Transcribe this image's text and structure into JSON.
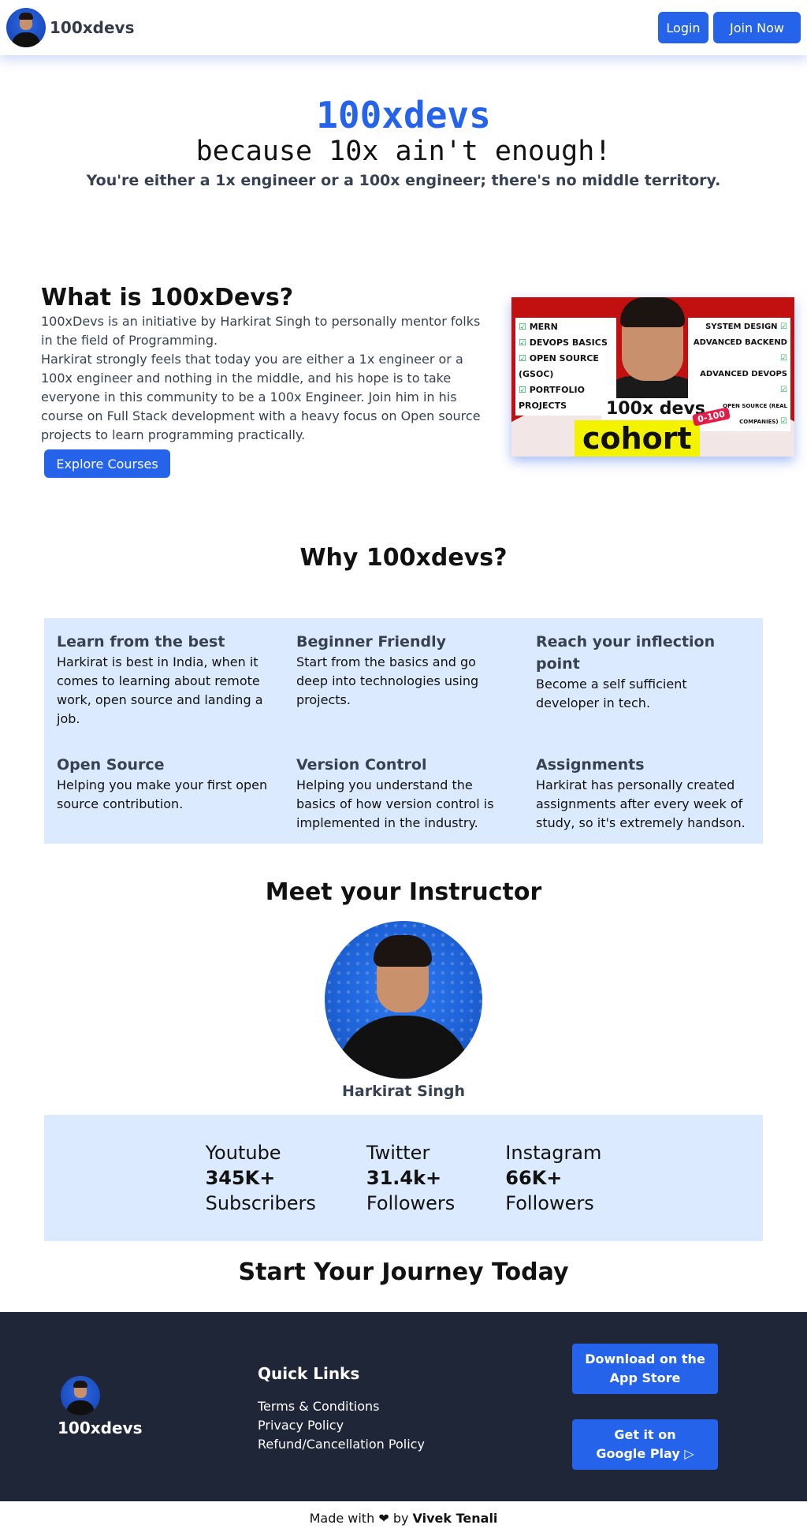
{
  "nav": {
    "brand": "100xdevs",
    "login": "Login",
    "join": "Join Now"
  },
  "hero": {
    "title": "100xdevs",
    "subtitle": "because 10x ain't enough!",
    "tagline": "You're either a 1x engineer or a 100x engineer; there's no middle territory."
  },
  "about": {
    "title": "What is 100xDevs?",
    "para1": "100xDevs is an initiative by Harkirat Singh to personally mentor folks in the field of Programming.",
    "para2": "Harkirat strongly feels that today you are either a 1x engineer or a 100x engineer and nothing in the middle, and his hope is to take everyone in this community to be a 100x Engineer. Join him in his course on Full Stack development with a heavy focus on Open source projects to learn programming practically.",
    "cta": "Explore Courses",
    "cover": {
      "left_items": [
        "MERN",
        "DEVOPS BASICS",
        "OPEN SOURCE (GSOC)",
        "PORTFOLIO PROJECTS"
      ],
      "right_items": [
        "SYSTEM DESIGN",
        "ADVANCED BACKEND",
        "ADVANCED DEVOPS",
        "OPEN SOURCE (REAL COMPANIES)"
      ],
      "label": "100x devs",
      "badge": "0-100",
      "big": "cohort"
    }
  },
  "why": {
    "title": "Why 100xdevs?",
    "features": [
      {
        "title": "Learn from the best",
        "desc": "Harkirat is best in India, when it comes to learning about remote work, open source and landing a job."
      },
      {
        "title": "Beginner Friendly",
        "desc": "Start from the basics and go deep into technologies using projects."
      },
      {
        "title": "Reach your inflection point",
        "desc": "Become a self sufficient developer in tech."
      },
      {
        "title": "Open Source",
        "desc": "Helping you make your first open source contribution."
      },
      {
        "title": "Version Control",
        "desc": "Helping you understand the basics of how version control is implemented in the industry."
      },
      {
        "title": "Assignments",
        "desc": "Harkirat has personally created assignments after every week of study, so it's extremely handson."
      }
    ]
  },
  "instructor": {
    "title": "Meet your Instructor",
    "name": "Harkirat Singh"
  },
  "stats": [
    {
      "platform": "Youtube",
      "count": "345K+",
      "unit": "Subscribers"
    },
    {
      "platform": "Twitter",
      "count": "31.4k+",
      "unit": "Followers"
    },
    {
      "platform": "Instagram",
      "count": "66K+",
      "unit": "Followers"
    }
  ],
  "journey": "Start Your Journey Today",
  "footer": {
    "brand": "100xdevs",
    "quick_title": "Quick Links",
    "links": [
      "Terms & Conditions",
      "Privacy Policy",
      "Refund/Cancellation Policy"
    ],
    "app_store": {
      "line1": "Download on the",
      "line2": "App Store"
    },
    "play_store": {
      "line1": "Get it on",
      "line2": "Google Play"
    }
  },
  "credit": {
    "prefix": "Made with",
    "heart": "❤",
    "by": "by",
    "author": "Vivek Tenali"
  },
  "colors": {
    "accent": "#2563eb",
    "light_panel": "#dbeafe",
    "footer_bg": "#1f2638"
  }
}
